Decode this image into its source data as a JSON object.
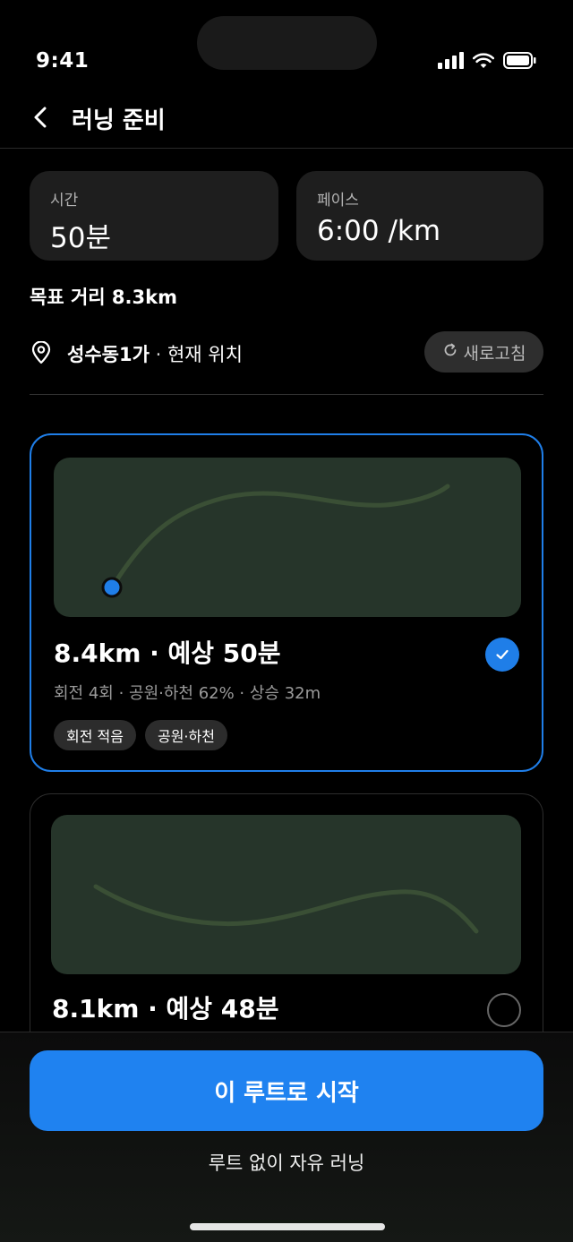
{
  "status_bar": {
    "time": "9:41",
    "icons": [
      "signal-icon",
      "wifi-icon",
      "battery-icon"
    ]
  },
  "nav": {
    "back_icon": "chevron-left-icon",
    "title": "러닝 준비"
  },
  "stats": {
    "time": {
      "label": "시간",
      "value": "50분"
    },
    "pace": {
      "label": "페이스",
      "value": "6:00 /km"
    }
  },
  "target_distance": "목표 거리 8.3km",
  "location": {
    "icon": "map-pin-icon",
    "name": "성수동1가",
    "separator": " · ",
    "suffix": "현재 위치",
    "refresh_label": "새로고침",
    "refresh_icon": "refresh-icon"
  },
  "routes": [
    {
      "title": "8.4km · 예상 50분",
      "meta": "회전 4회 · 공원·하천 62% · 상승 32m",
      "tags": [
        "회전 적음",
        "공원·하천"
      ],
      "selected": true
    },
    {
      "title": "8.1km · 예상 48분",
      "selected": false
    }
  ],
  "actions": {
    "start_label": "이 루트로 시작",
    "free_run_label": "루트 없이 자유 러닝"
  },
  "colors": {
    "accent": "#1f82f0",
    "background": "#000000",
    "card": "#1e1e1e",
    "map": "#26352a",
    "route_line": "#3a4f35"
  }
}
